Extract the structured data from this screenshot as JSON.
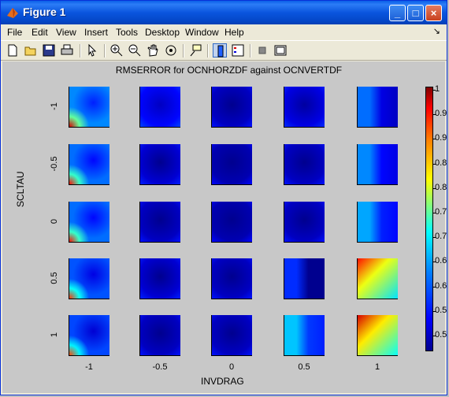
{
  "window": {
    "title": "Figure 1",
    "controls": [
      "_",
      "□",
      "×"
    ]
  },
  "menubar": {
    "items": [
      "File",
      "Edit",
      "View",
      "Insert",
      "Tools",
      "Desktop",
      "Window",
      "Help"
    ],
    "arrow": "↘"
  },
  "toolbar": {
    "tools": [
      "new-file-icon",
      "open-folder-icon",
      "save-icon",
      "print-icon",
      "pointer-icon",
      "zoom-in-icon",
      "zoom-out-icon",
      "pan-hand-icon",
      "rotate-3d-icon",
      "data-cursor-icon",
      "colorbar-icon",
      "legend-icon",
      "hide-plot-tools-icon",
      "show-plot-tools-icon"
    ]
  },
  "chart_data": {
    "type": "heatmap",
    "title": "RMSERROR for OCNHORZDF against OCNVERTDF",
    "xlabel": "INVDRAG",
    "ylabel": "SCLTAU",
    "x_ticks": [
      "-1",
      "-0.5",
      "0",
      "0.5",
      "1"
    ],
    "y_ticks": [
      "-1",
      "-0.5",
      "0",
      "0.5",
      "1"
    ],
    "colorbar": {
      "ticks": [
        "1",
        "0.9",
        "0.9",
        "0.8",
        "0.8",
        "0.7",
        "0.7",
        "0.6",
        "0.6",
        "0.5",
        "0.5"
      ],
      "range": [
        0.45,
        1.0
      ]
    },
    "panels_description_values": [
      [
        0.62,
        0.52,
        0.48,
        0.5,
        0.6
      ],
      [
        0.6,
        0.49,
        0.47,
        0.48,
        0.62
      ],
      [
        0.6,
        0.48,
        0.47,
        0.48,
        0.64
      ],
      [
        0.58,
        0.49,
        0.48,
        0.55,
        0.8
      ],
      [
        0.57,
        0.48,
        0.48,
        0.66,
        0.82
      ]
    ]
  }
}
